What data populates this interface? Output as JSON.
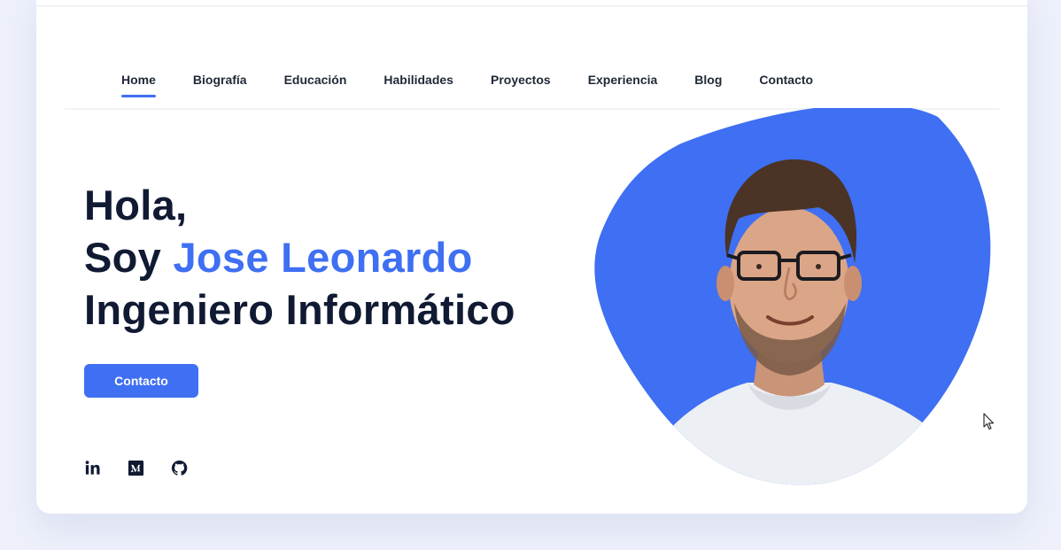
{
  "nav": {
    "items": [
      {
        "label": "Home",
        "active": true
      },
      {
        "label": "Biografía",
        "active": false
      },
      {
        "label": "Educación",
        "active": false
      },
      {
        "label": "Habilidades",
        "active": false
      },
      {
        "label": "Proyectos",
        "active": false
      },
      {
        "label": "Experiencia",
        "active": false
      },
      {
        "label": "Blog",
        "active": false
      },
      {
        "label": "Contacto",
        "active": false
      }
    ]
  },
  "hero": {
    "greeting": "Hola,",
    "intro_prefix": "Soy ",
    "name": "Jose Leonardo",
    "title": "Ingeniero Informático",
    "cta_label": "Contacto"
  },
  "socials": [
    {
      "icon": "linkedin-icon"
    },
    {
      "icon": "medium-icon"
    },
    {
      "icon": "github-icon"
    }
  ],
  "colors": {
    "accent": "#3f6ff2",
    "heading": "#111a33",
    "background": "#eef1fb"
  }
}
